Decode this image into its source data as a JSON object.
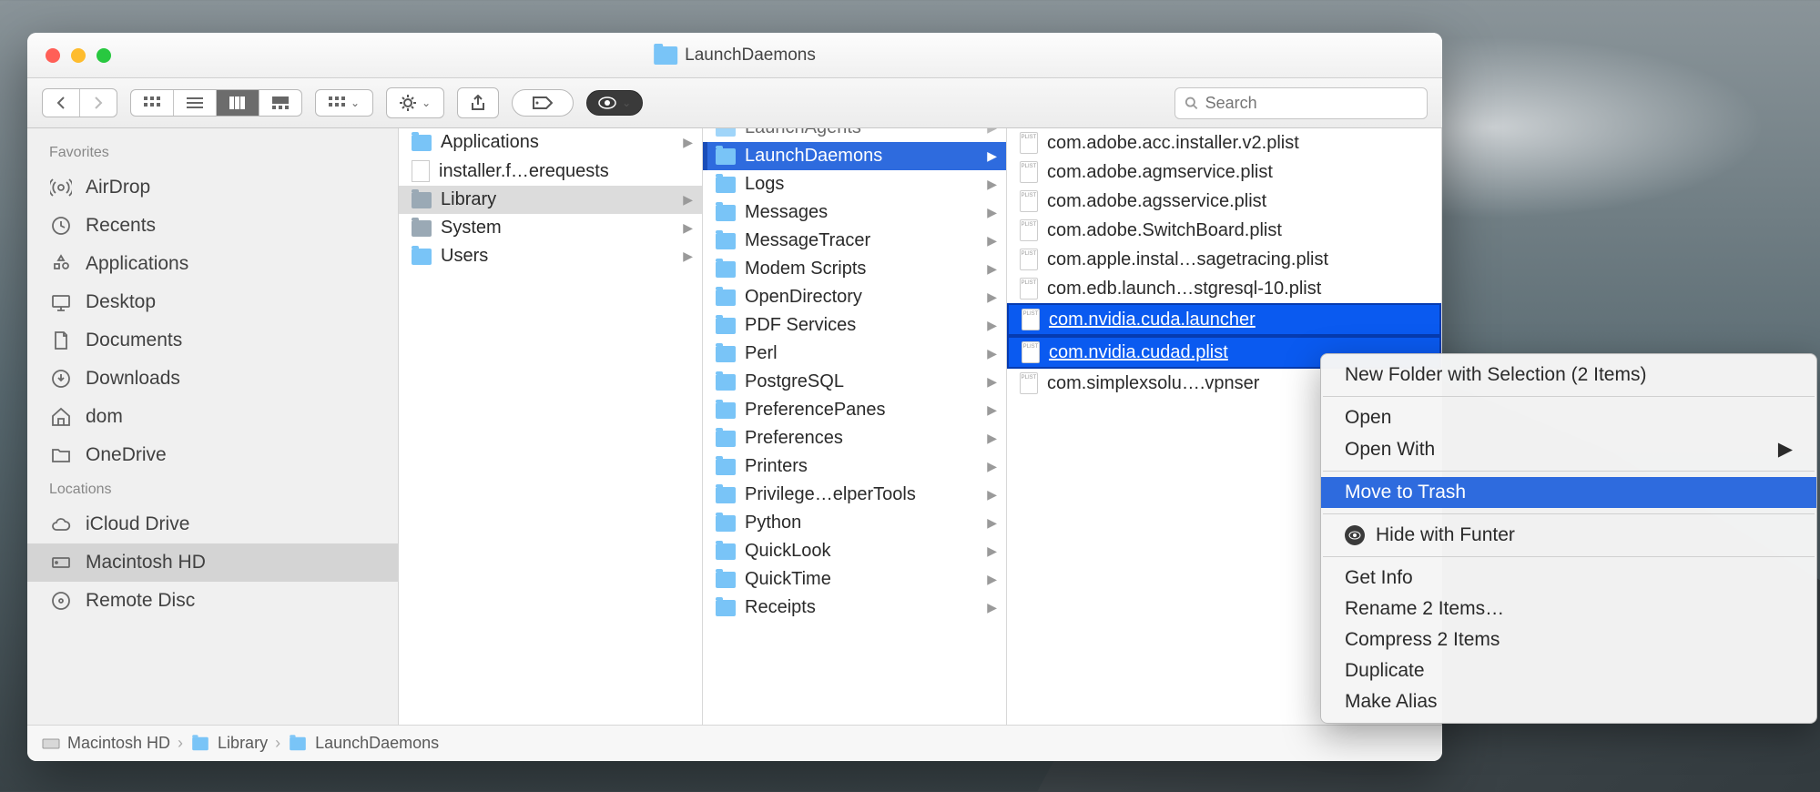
{
  "window": {
    "title": "LaunchDaemons"
  },
  "search": {
    "placeholder": "Search"
  },
  "sidebar": {
    "sections": [
      {
        "header": "Favorites",
        "items": [
          {
            "icon": "airdrop",
            "label": "AirDrop"
          },
          {
            "icon": "recents",
            "label": "Recents"
          },
          {
            "icon": "apps",
            "label": "Applications"
          },
          {
            "icon": "desktop",
            "label": "Desktop"
          },
          {
            "icon": "docs",
            "label": "Documents"
          },
          {
            "icon": "downloads",
            "label": "Downloads"
          },
          {
            "icon": "home",
            "label": "dom"
          },
          {
            "icon": "folder",
            "label": "OneDrive"
          }
        ]
      },
      {
        "header": "Locations",
        "items": [
          {
            "icon": "icloud",
            "label": "iCloud Drive"
          },
          {
            "icon": "hd",
            "label": "Macintosh HD",
            "selected": true
          },
          {
            "icon": "disc",
            "label": "Remote Disc"
          }
        ]
      }
    ]
  },
  "columns": {
    "c1": [
      {
        "type": "folder",
        "name": "Applications",
        "arrow": true
      },
      {
        "type": "doc",
        "name": "installer.f…erequests"
      },
      {
        "type": "sysfolder",
        "name": "Library",
        "arrow": true,
        "selected": true
      },
      {
        "type": "sysfolder",
        "name": "System",
        "arrow": true
      },
      {
        "type": "folder",
        "name": "Users",
        "arrow": true
      }
    ],
    "c2": [
      {
        "type": "folder",
        "name": "LaunchAgents",
        "arrow": true,
        "partial": true
      },
      {
        "type": "folder",
        "name": "LaunchDaemons",
        "arrow": true,
        "selected": true
      },
      {
        "type": "folder",
        "name": "Logs",
        "arrow": true
      },
      {
        "type": "folder",
        "name": "Messages",
        "arrow": true
      },
      {
        "type": "folder",
        "name": "MessageTracer",
        "arrow": true
      },
      {
        "type": "folder",
        "name": "Modem Scripts",
        "arrow": true
      },
      {
        "type": "folder",
        "name": "OpenDirectory",
        "arrow": true
      },
      {
        "type": "folder",
        "name": "PDF Services",
        "arrow": true
      },
      {
        "type": "folder",
        "name": "Perl",
        "arrow": true
      },
      {
        "type": "folder",
        "name": "PostgreSQL",
        "arrow": true
      },
      {
        "type": "folder",
        "name": "PreferencePanes",
        "arrow": true
      },
      {
        "type": "folder",
        "name": "Preferences",
        "arrow": true
      },
      {
        "type": "folder",
        "name": "Printers",
        "arrow": true
      },
      {
        "type": "folder",
        "name": "Privilege…elperTools",
        "arrow": true
      },
      {
        "type": "folder",
        "name": "Python",
        "arrow": true
      },
      {
        "type": "folder",
        "name": "QuickLook",
        "arrow": true
      },
      {
        "type": "folder",
        "name": "QuickTime",
        "arrow": true
      },
      {
        "type": "folder",
        "name": "Receipts",
        "arrow": true
      }
    ],
    "c3": [
      {
        "type": "plist",
        "name": "com.adobe.acc.installer.v2.plist"
      },
      {
        "type": "plist",
        "name": "com.adobe.agmservice.plist"
      },
      {
        "type": "plist",
        "name": "com.adobe.agsservice.plist"
      },
      {
        "type": "plist",
        "name": "com.adobe.SwitchBoard.plist"
      },
      {
        "type": "plist",
        "name": "com.apple.instal…sagetracing.plist"
      },
      {
        "type": "plist",
        "name": "com.edb.launch…stgresql-10.plist"
      },
      {
        "type": "plist",
        "name": "com.nvidia.cuda.launcher",
        "cut": true
      },
      {
        "type": "plist",
        "name": "com.nvidia.cudad.plist",
        "cut": true
      },
      {
        "type": "plist",
        "name": "com.simplexsolu….vpnser"
      }
    ]
  },
  "pathbar": [
    {
      "icon": "hd",
      "label": "Macintosh HD"
    },
    {
      "icon": "folder",
      "label": "Library"
    },
    {
      "icon": "folder",
      "label": "LaunchDaemons"
    }
  ],
  "context_menu": {
    "items": [
      {
        "label": "New Folder with Selection (2 Items)"
      },
      {
        "sep": true
      },
      {
        "label": "Open"
      },
      {
        "label": "Open With",
        "submenu": true
      },
      {
        "sep": true
      },
      {
        "label": "Move to Trash",
        "highlighted": true
      },
      {
        "sep": true
      },
      {
        "label": "Hide with Funter",
        "icon": "eye"
      },
      {
        "sep": true
      },
      {
        "label": "Get Info"
      },
      {
        "label": "Rename 2 Items…"
      },
      {
        "label": "Compress 2 Items"
      },
      {
        "label": "Duplicate"
      },
      {
        "label": "Make Alias"
      }
    ]
  }
}
